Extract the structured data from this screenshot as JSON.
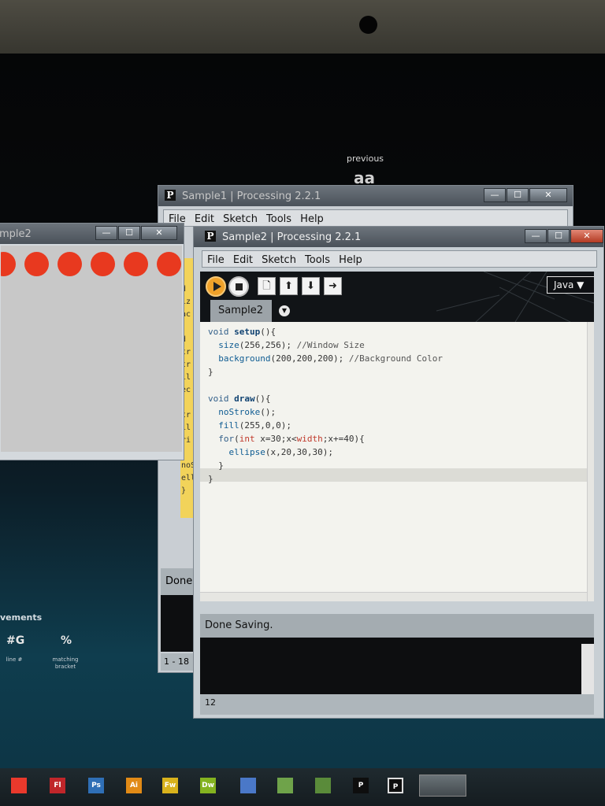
{
  "desktop": {
    "previous_label": "previous",
    "previous_key": "aa",
    "shortcuts_title": "vements",
    "shortcuts": [
      {
        "key": "#G",
        "desc": "line #"
      },
      {
        "key": "%",
        "desc": "matching bracket"
      }
    ]
  },
  "window_back": {
    "title": "Sample1 | Processing 2.2.1",
    "menus": [
      "File",
      "Edit",
      "Sketch",
      "Tools",
      "Help"
    ],
    "status": "Done",
    "line_number": "1 - 18",
    "partial_code": [
      "d",
      "iz",
      "ac",
      "",
      "d",
      "tr",
      "tr",
      "il",
      "ec",
      "",
      "tr",
      "il",
      "ri",
      "",
      "noS",
      "ell",
      "}"
    ]
  },
  "window_sketch": {
    "title": "mple2",
    "dot_count": 6,
    "dot_color": "#e8391f",
    "background_color": "#c8c8c8"
  },
  "window_main": {
    "title": "Sample2 | Processing 2.2.1",
    "menus": [
      "File",
      "Edit",
      "Sketch",
      "Tools",
      "Help"
    ],
    "toolbar": {
      "run": "run-icon",
      "stop": "stop-icon",
      "new": "new-icon",
      "open": "open-icon",
      "save": "save-icon",
      "export": "export-icon"
    },
    "mode": "Java ▼",
    "tab_name": "Sample2",
    "tab_menu": "▼",
    "code": [
      "void setup(){",
      "  size(256,256); //Window Size",
      "  background(200,200,200); //Background Color",
      "}",
      "",
      "void draw(){",
      "  noStroke();",
      "  fill(255,0,0);",
      "  for(int x=30;x<width;x+=40){",
      "    ellipse(x,20,30,30);",
      "  }",
      "}"
    ],
    "status": "Done Saving.",
    "line_number": "12"
  },
  "window_controls": {
    "minimize": "—",
    "maximize": "☐",
    "close": "✕"
  },
  "taskbar": [
    {
      "name": "acrobat-icon",
      "label": "",
      "color": "#e9392c"
    },
    {
      "name": "flash-icon",
      "label": "Fl",
      "color": "#c0262a"
    },
    {
      "name": "photoshop-icon",
      "label": "Ps",
      "color": "#2f6fb6"
    },
    {
      "name": "illustrator-icon",
      "label": "Ai",
      "color": "#e18a16"
    },
    {
      "name": "fireworks-icon",
      "label": "Fw",
      "color": "#d8b21c"
    },
    {
      "name": "dreamweaver-icon",
      "label": "Dw",
      "color": "#84b320"
    },
    {
      "name": "app-icon-1",
      "label": "",
      "color": "#4a78c8"
    },
    {
      "name": "app-icon-2",
      "label": "",
      "color": "#6fa34a"
    },
    {
      "name": "app-icon-3",
      "label": "",
      "color": "#5a8b3a"
    },
    {
      "name": "processing-icon-1",
      "label": "P",
      "color": "#0e0e0e"
    },
    {
      "name": "processing-icon-2",
      "label": "P",
      "color": "#0e0e0e"
    }
  ]
}
